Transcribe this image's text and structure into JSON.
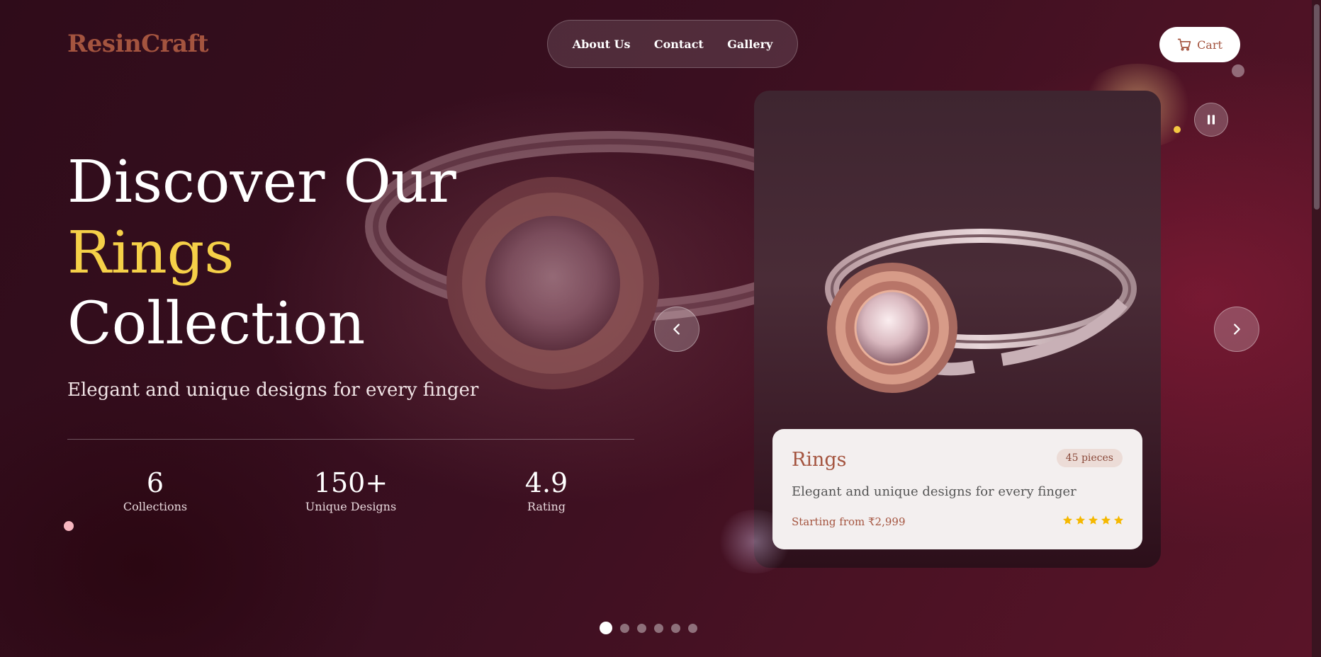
{
  "brand": {
    "logo": "ResinCraft"
  },
  "nav": {
    "items": [
      "About Us",
      "Contact",
      "Gallery"
    ]
  },
  "cart": {
    "label": "Cart",
    "icon": "cart-icon"
  },
  "hero": {
    "title_line1": "Discover Our",
    "title_accent": "Rings",
    "title_line3": "Collection",
    "subtitle": "Elegant and unique designs for every finger"
  },
  "stats": [
    {
      "value": "6",
      "label": "Collections"
    },
    {
      "value": "150+",
      "label": "Unique Designs"
    },
    {
      "value": "4.9",
      "label": "Rating"
    }
  ],
  "product_card": {
    "name": "Rings",
    "badge": "45 pieces",
    "description": "Elegant and unique designs for every finger",
    "price": "Starting from ₹2,999",
    "rating_stars": 5
  },
  "carousel": {
    "slide_count": 6,
    "active_slide": 1,
    "controls": [
      "prev-arrow-icon",
      "next-arrow-icon",
      "pause-icon"
    ]
  },
  "colors": {
    "brand": "#a4543f",
    "accent": "#f5d048",
    "star": "#f5b800",
    "card_bg": "#f3efef"
  }
}
